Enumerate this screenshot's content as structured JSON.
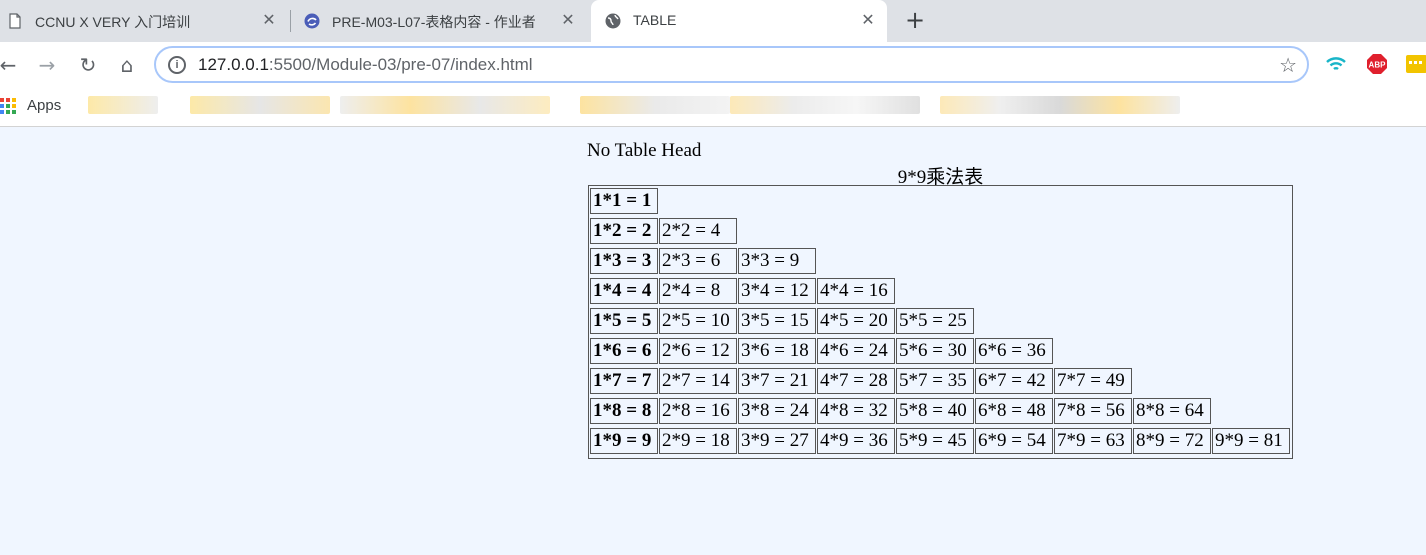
{
  "browser": {
    "tabs": [
      {
        "title": "CCNU X VERY 入门培训",
        "active": false
      },
      {
        "title": "PRE-M03-L07-表格内容 - 作业者",
        "active": false
      },
      {
        "title": "TABLE",
        "active": true
      }
    ],
    "close_glyph": "✕",
    "new_tab_glyph": "+",
    "address": {
      "host": "127.0.0.1",
      "path": ":5500/Module-03/pre-07/index.html"
    },
    "nav": {
      "back": "←",
      "forward": "→",
      "reload": "↻",
      "home": "⌂"
    },
    "star_glyph": "☆",
    "bookmarks": {
      "apps_label": "Apps"
    },
    "extensions": {
      "abp_label": "ABP"
    }
  },
  "page": {
    "heading": "No Table Head",
    "caption": "9*9乘法表"
  },
  "chart_data": {
    "type": "table",
    "caption": "9*9乘法表",
    "rows": [
      [
        "1*1 = 1"
      ],
      [
        "1*2 = 2",
        "2*2 = 4"
      ],
      [
        "1*3 = 3",
        "2*3 = 6",
        "3*3 = 9"
      ],
      [
        "1*4 = 4",
        "2*4 = 8",
        "3*4 = 12",
        "4*4 = 16"
      ],
      [
        "1*5 = 5",
        "2*5 = 10",
        "3*5 = 15",
        "4*5 = 20",
        "5*5 = 25"
      ],
      [
        "1*6 = 6",
        "2*6 = 12",
        "3*6 = 18",
        "4*6 = 24",
        "5*6 = 30",
        "6*6 = 36"
      ],
      [
        "1*7 = 7",
        "2*7 = 14",
        "3*7 = 21",
        "4*7 = 28",
        "5*7 = 35",
        "6*7 = 42",
        "7*7 = 49"
      ],
      [
        "1*8 = 8",
        "2*8 = 16",
        "3*8 = 24",
        "4*8 = 32",
        "5*8 = 40",
        "6*8 = 48",
        "7*8 = 56",
        "8*8 = 64"
      ],
      [
        "1*9 = 9",
        "2*9 = 18",
        "3*9 = 27",
        "4*9 = 36",
        "5*9 = 45",
        "6*9 = 54",
        "7*9 = 63",
        "8*9 = 72",
        "9*9 = 81"
      ]
    ]
  }
}
